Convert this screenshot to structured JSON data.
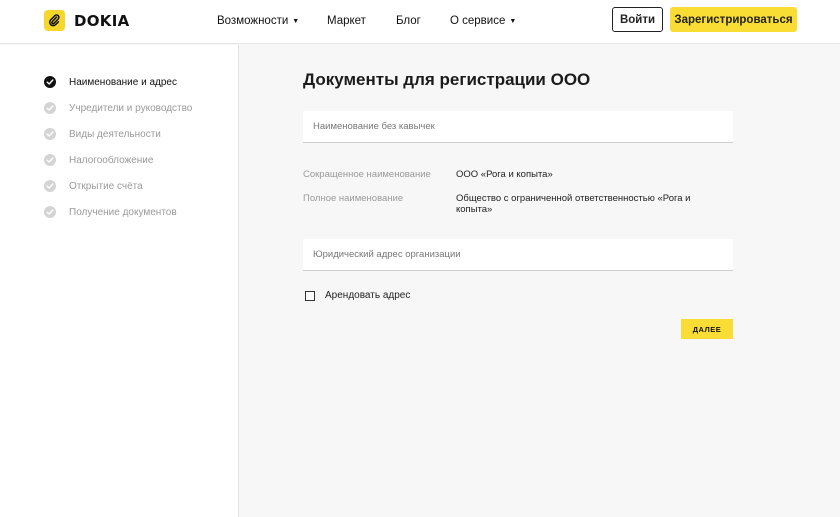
{
  "header": {
    "brand": "DOKIA",
    "nav": [
      {
        "label": "Возможности",
        "has_dropdown": true
      },
      {
        "label": "Маркет",
        "has_dropdown": false
      },
      {
        "label": "Блог",
        "has_dropdown": false
      },
      {
        "label": "О сервисе",
        "has_dropdown": true
      }
    ],
    "login_label": "Войти",
    "register_label": "Зарегистрироваться"
  },
  "sidebar": {
    "steps": [
      {
        "label": "Наименование и адрес",
        "active": true
      },
      {
        "label": "Учредители и руководство",
        "active": false
      },
      {
        "label": "Виды деятельности",
        "active": false
      },
      {
        "label": "Налогообложение",
        "active": false
      },
      {
        "label": "Открытие счёта",
        "active": false
      },
      {
        "label": "Получение документов",
        "active": false
      }
    ]
  },
  "main": {
    "title": "Документы для регистрации ООО",
    "name_field_placeholder": "Наименование без кавычек",
    "short_name_label": "Сокращенное наименование",
    "short_name_value": "ООО «Рога и копыта»",
    "full_name_label": "Полное наименование",
    "full_name_value_line1": "Общество с ограниченной ответственностью «Рога и",
    "full_name_value_line2": "копыта»",
    "address_field_placeholder": "Юридический адрес организации",
    "rent_address_label": "Арендовать адрес",
    "rent_address_checked": false,
    "next_label": "ДАЛЕЕ"
  },
  "colors": {
    "accent": "#f9dd35",
    "background": "#f7f7f7"
  }
}
